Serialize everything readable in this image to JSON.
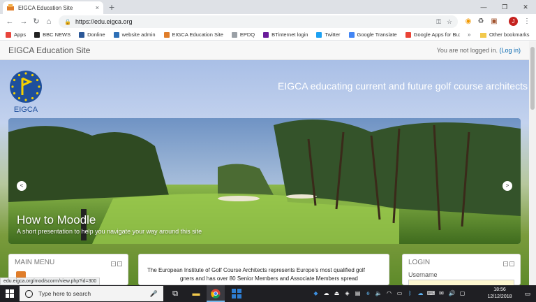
{
  "browser": {
    "tab_title": "EIGCA Education Site",
    "tab_close": "×",
    "new_tab": "+",
    "window_controls": {
      "minimize": "—",
      "maximize": "❐",
      "close": "✕"
    },
    "url": "https://edu.eigca.org",
    "profile_initial": "J"
  },
  "bookmarks": {
    "items": [
      {
        "label": "Apps",
        "icon": "apps-grid-icon",
        "color": "#e8453c"
      },
      {
        "label": "BBC NEWS",
        "icon": "bbc-icon",
        "color": "#222222"
      },
      {
        "label": "Donline",
        "icon": "donline-icon",
        "color": "#2b5797"
      },
      {
        "label": "website admin",
        "icon": "globe-icon",
        "color": "#2d6fb6"
      },
      {
        "label": "EIGCA Education Site",
        "icon": "eigca-icon",
        "color": "#e07d2a"
      },
      {
        "label": "EPDQ",
        "icon": "page-icon",
        "color": "#9aa0a6"
      },
      {
        "label": "BTinternet login",
        "icon": "bt-icon",
        "color": "#6a1b9a"
      },
      {
        "label": "Twitter",
        "icon": "twitter-icon",
        "color": "#1da1f2"
      },
      {
        "label": "Google Translate",
        "icon": "translate-icon",
        "color": "#4285f4"
      },
      {
        "label": "Google Apps for Bu:",
        "icon": "google-icon",
        "color": "#ea4335"
      }
    ],
    "more": "»",
    "other": "Other bookmarks"
  },
  "site": {
    "brand": "EIGCA Education Site",
    "login_status": "You are not logged in.",
    "login_link": "(Log in)",
    "logo_text": "EIGCA",
    "tagline": "EIGCA educating current and future golf course architects"
  },
  "carousel": {
    "slide_title": "How to Moodle",
    "slide_subtitle": "A short presentation to help you navigate your way around this site",
    "prev": "<",
    "next": ">"
  },
  "blocks": {
    "main_menu_title": "MAIN MENU",
    "intro_line1": "The European Institute of Golf Course Architects represents Europe's most qualified golf",
    "intro_line2": "gners and has over 80 Senior Members and Associate Members spread",
    "login_title": "LOGIN",
    "username_label": "Username"
  },
  "status_bar_url": "edu.eigca.org/mod/scorm/view.php?id=300",
  "taskbar": {
    "search_placeholder": "Type here to search",
    "time": "18:56",
    "date": "12/12/2018"
  }
}
